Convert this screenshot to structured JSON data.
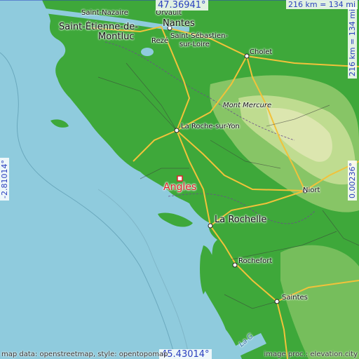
{
  "map": {
    "style": "opentopomap",
    "colors": {
      "sea": "#8fcbdd",
      "land": "#3ea83a",
      "highland": "#d7e6a8",
      "road": "#f2c23a",
      "marker": "#e0202a",
      "coord_text": "#2a3fbf"
    }
  },
  "target": {
    "name": "Angles",
    "icon": "square-marker-icon"
  },
  "cities": [
    {
      "name": "Saint-Nazaire"
    },
    {
      "name": "Orvault"
    },
    {
      "name": "Nantes"
    },
    {
      "name": "Saint-Étienne-de-"
    },
    {
      "name": "Montluc"
    },
    {
      "name": "Rezé"
    },
    {
      "name": "Saint-Sébastien-"
    },
    {
      "name": "sur-Loire"
    },
    {
      "name": "Cholet"
    },
    {
      "name": "Mont Mercure"
    },
    {
      "name": "La Roche-sur-Yon"
    },
    {
      "name": "Niort"
    },
    {
      "name": "La Rochelle"
    },
    {
      "name": "Rochefort"
    },
    {
      "name": "Saintes"
    },
    {
      "name": "La G"
    }
  ],
  "coords": {
    "top": "47.36941°",
    "bottom": "45.43014°",
    "left": "-2.81014°",
    "right": "0.00236°",
    "scale_h": "216 km = 134 mi",
    "scale_v": "216 km = 134 mi"
  },
  "footer": {
    "left": "map data: openstreetmap, style: opentopomap",
    "right": "image proc.: elevation.city"
  }
}
